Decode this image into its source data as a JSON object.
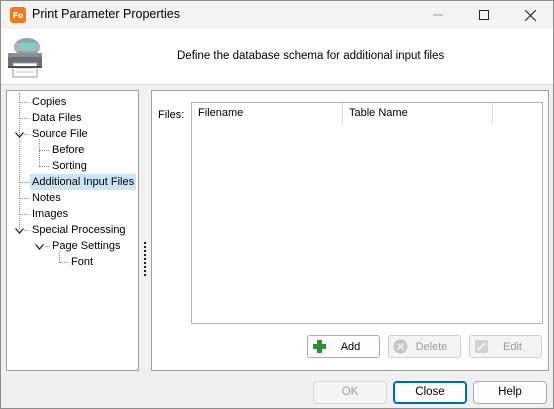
{
  "window": {
    "title": "Print Parameter Properties",
    "app_icon_text": "Fo"
  },
  "header": {
    "description": "Define the database schema for additional input files"
  },
  "tree": {
    "items": [
      {
        "label": "Copies"
      },
      {
        "label": "Data Files"
      },
      {
        "label": "Source File"
      },
      {
        "label": "Before"
      },
      {
        "label": "Sorting"
      },
      {
        "label": "Additional Input Files"
      },
      {
        "label": "Notes"
      },
      {
        "label": "Images"
      },
      {
        "label": "Special Processing"
      },
      {
        "label": "Page Settings"
      },
      {
        "label": "Font"
      }
    ],
    "selected": "Additional Input Files"
  },
  "files": {
    "label": "Files:",
    "columns": [
      "Filename",
      "Table Name"
    ],
    "rows": []
  },
  "actions": {
    "add": "Add",
    "delete": "Delete",
    "edit": "Edit"
  },
  "footer": {
    "ok": "OK",
    "close": "Close",
    "help": "Help"
  },
  "colors": {
    "selection": "#cce4f7",
    "accent": "#0067c0",
    "app_icon": "#f07a1a",
    "add_icon": "#2e8b2e"
  }
}
